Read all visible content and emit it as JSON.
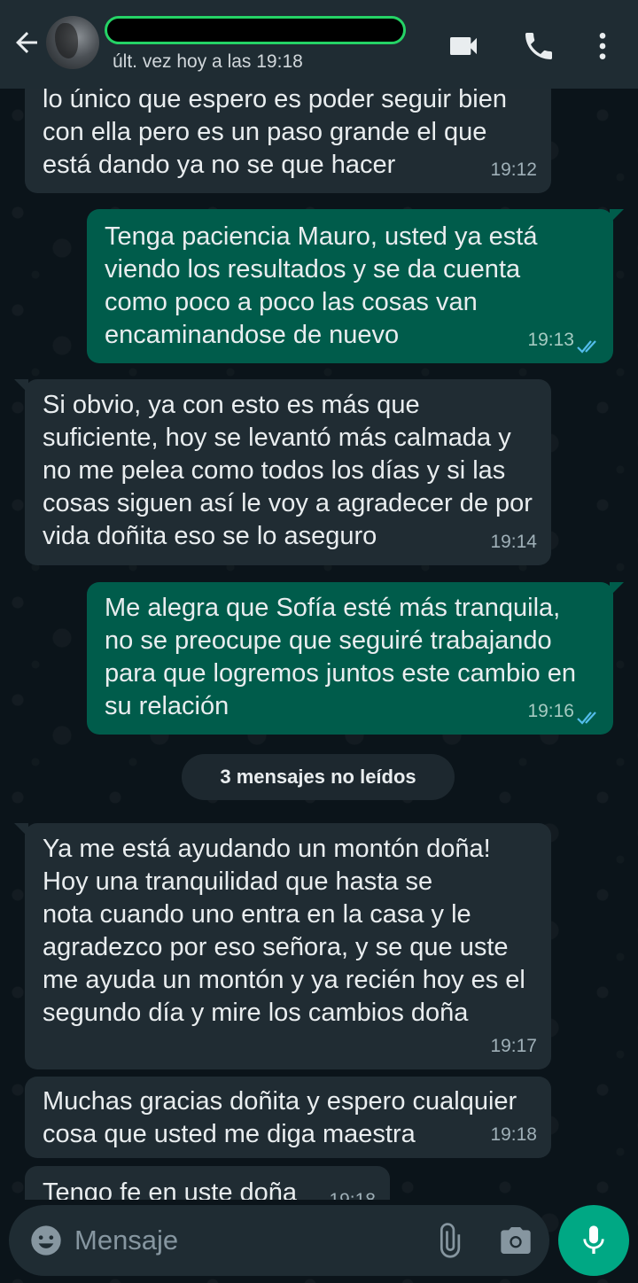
{
  "header": {
    "contact_status": "últ. vez hoy a las 19:18"
  },
  "messages": [
    {
      "direction": "in",
      "text": "lo único que espero es poder seguir bien\ncon ella pero es un paso grande el que\nestá dando ya no se que hacer",
      "time": "19:12"
    },
    {
      "direction": "out",
      "text": "Tenga paciencia Mauro, usted ya está\nviendo los resultados y se da cuenta\ncomo poco a poco las cosas van\nencaminandose de nuevo",
      "time": "19:13",
      "status": "read"
    },
    {
      "direction": "in",
      "text": "Si obvio, ya con esto es más que\nsuficiente, hoy se levantó más calmada y\nno me pelea como todos los días y si las\ncosas siguen así le voy a agradecer de por\nvida doñita eso se lo aseguro",
      "time": "19:14"
    },
    {
      "direction": "out",
      "text": "Me alegra que Sofía esté más tranquila,\nno se preocupe que seguiré trabajando\npara que logremos juntos este cambio en\nsu relación",
      "time": "19:16",
      "status": "read"
    },
    {
      "direction": "in",
      "text": "Ya me está ayudando un montón doña!\nHoy una tranquilidad que hasta se\nnota cuando uno entra en la casa y le\nagradezco por eso señora, y se que uste\nme ayuda un montón y ya recién hoy es el\nsegundo día y mire los cambios doña",
      "time": "19:17"
    },
    {
      "direction": "in",
      "text": "Muchas gracias doñita y espero cualquier\ncosa que usted me diga maestra",
      "time": "19:18"
    },
    {
      "direction": "in",
      "text": "Tengo fe en uste doña",
      "time": "19:18"
    }
  ],
  "unread_divider": "3 mensajes no leídos",
  "composer": {
    "placeholder": "Mensaje"
  },
  "colors": {
    "background": "#0b141a",
    "header": "#1f2c33",
    "incoming_bubble": "#202c33",
    "outgoing_bubble": "#005c4b",
    "read_ticks": "#53bdeb",
    "mic_button": "#00a884",
    "redaction_border": "#25d366"
  },
  "icons": [
    "back-arrow-icon",
    "video-call-icon",
    "phone-icon",
    "more-vert-icon",
    "emoji-icon",
    "attach-icon",
    "camera-icon",
    "mic-icon"
  ]
}
